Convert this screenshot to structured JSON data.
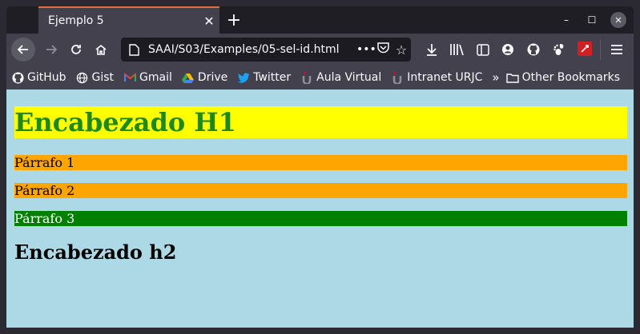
{
  "browser": {
    "tab_title": "Ejemplo 5",
    "tab_close": "✕",
    "new_tab": "+",
    "url": "SAAI/S03/Examples/05-sel-id.html",
    "url_more": "•••",
    "win_min": "–",
    "win_max": "☐",
    "win_close": "✕"
  },
  "bookmarks": [
    {
      "label": "GitHub",
      "icon": "github-icon"
    },
    {
      "label": "Gist",
      "icon": "globe-icon"
    },
    {
      "label": "Gmail",
      "icon": "gmail-icon"
    },
    {
      "label": "Drive",
      "icon": "drive-icon"
    },
    {
      "label": "Twitter",
      "icon": "twitter-icon"
    },
    {
      "label": "Aula Virtual",
      "icon": "urjc-icon"
    },
    {
      "label": "Intranet URJC",
      "icon": "urjc-icon"
    },
    {
      "label": "Other Bookmarks",
      "icon": "folder-icon"
    }
  ],
  "page": {
    "h1": "Encabezado H1",
    "p1": "Párrafo 1",
    "p2": "Párrafo 2",
    "p3": "Párrafo 3",
    "h2": "Encabezado h2"
  },
  "colors": {
    "page_bg": "#add8e6",
    "h1_bg": "#ffff00",
    "h1_text": "#008000",
    "p_orange": "#ffa500",
    "p_green": "#008000"
  }
}
